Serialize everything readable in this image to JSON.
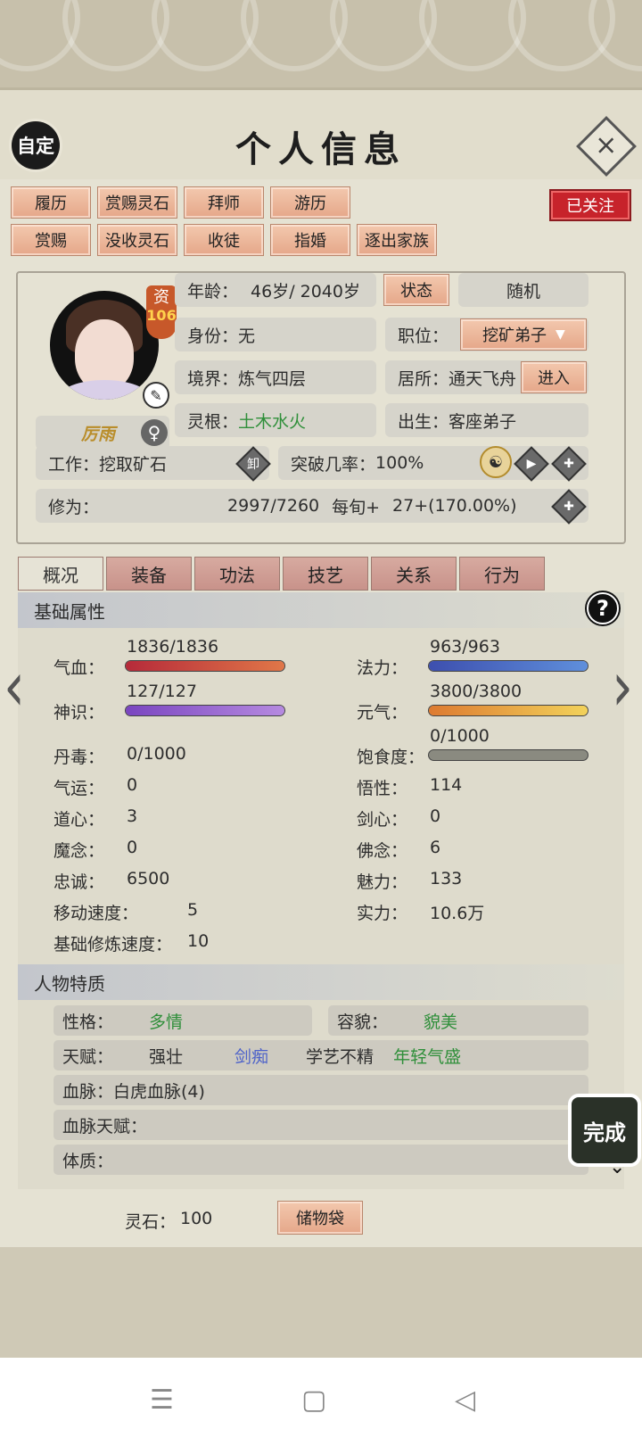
{
  "header": {
    "title": "个人信息",
    "auto_label": "自定",
    "close_symbol": "×"
  },
  "actions_row1": [
    "履历",
    "赏赐灵石",
    "拜师",
    "游历"
  ],
  "actions_row2": [
    "赏赐",
    "没收灵石",
    "收徒",
    "指婚",
    "逐出家族"
  ],
  "follow_label": "已关注",
  "character": {
    "name": "厉雨",
    "aptitude_label": "资",
    "aptitude_value": "106",
    "gender_symbol": "♀",
    "age_label": "年龄：",
    "age_value": "46岁/ 2040岁",
    "status_btn": "状态",
    "random_btn": "随机",
    "identity_label": "身份：",
    "identity_value": "无",
    "position_label": "职位：",
    "position_value": "挖矿弟子",
    "realm_label": "境界：",
    "realm_value": "炼气四层",
    "residence_label": "居所：",
    "residence_value": "通天飞舟",
    "enter_btn": "进入",
    "root_label": "灵根：",
    "root_value": "土木水火",
    "birth_label": "出生：",
    "birth_value": "客座弟子",
    "work_label": "工作：",
    "work_value": "挖取矿石",
    "unload_label": "卸",
    "breakthrough_label": "突破几率：",
    "breakthrough_value": "100%",
    "cultivation_label": "修为：",
    "cultivation_value": "2997/7260",
    "per_turn_label": "每旬+",
    "per_turn_value": "27+(170.00%)",
    "cultivation_progress": 0.4128
  },
  "tabs": [
    "概况",
    "装备",
    "功法",
    "技艺",
    "关系",
    "行为"
  ],
  "basic": {
    "title": "基础属性",
    "help": "?",
    "qixue_label": "气血：",
    "qixue_value": "1836/1836",
    "qixue_fill": 1.0,
    "fali_label": "法力：",
    "fali_value": "963/963",
    "fali_fill": 1.0,
    "shenshi_label": "神识：",
    "shenshi_value": "127/127",
    "shenshi_fill": 1.0,
    "yuanqi_label": "元气：",
    "yuanqi_value": "3800/3800",
    "yuanqi_fill": 1.0,
    "baoshi_label": "饱食度：",
    "baoshi_value": "0/1000",
    "baoshi_fill": 0.0,
    "left_stats": [
      {
        "label": "丹毒：",
        "value": "0/1000"
      },
      {
        "label": "气运：",
        "value": "0"
      },
      {
        "label": "道心：",
        "value": "3"
      },
      {
        "label": "魔念：",
        "value": "0"
      },
      {
        "label": "忠诚：",
        "value": "6500"
      },
      {
        "label": "移动速度：",
        "value": "5"
      },
      {
        "label": "基础修炼速度：",
        "value": "10"
      }
    ],
    "right_stats": [
      {
        "label": "悟性：",
        "value": "114"
      },
      {
        "label": "剑心：",
        "value": "0"
      },
      {
        "label": "佛念：",
        "value": "6"
      },
      {
        "label": "魅力：",
        "value": "133"
      },
      {
        "label": "实力：",
        "value": "10.6万"
      }
    ]
  },
  "traits": {
    "title": "人物特质",
    "personality_label": "性格：",
    "personality_value": "多情",
    "looks_label": "容貌：",
    "looks_value": "貌美",
    "talent_label": "天赋：",
    "talents": [
      "强壮",
      "剑痴",
      "学艺不精",
      "年轻气盛"
    ],
    "bloodline_label": "血脉：",
    "bloodline_value": "白虎血脉(4)",
    "bloodline_talent_label": "血脉天赋：",
    "physique_label": "体质："
  },
  "footer": {
    "spirit_stone_label": "灵石：",
    "spirit_stone_value": "100",
    "bag_btn": "储物袋"
  },
  "done_label": "完成",
  "colors": {
    "qixue": "#c43b3b",
    "fali": "#3f5fc0",
    "shenshi": "#8a55c9",
    "yuanqi": "#e08a2c",
    "baoshi": "#8a8a80",
    "green_text": "#2f8f3a",
    "blue_text": "#4d62c9",
    "accent_btn": "#e5a789",
    "follow_red": "#c7232b"
  }
}
